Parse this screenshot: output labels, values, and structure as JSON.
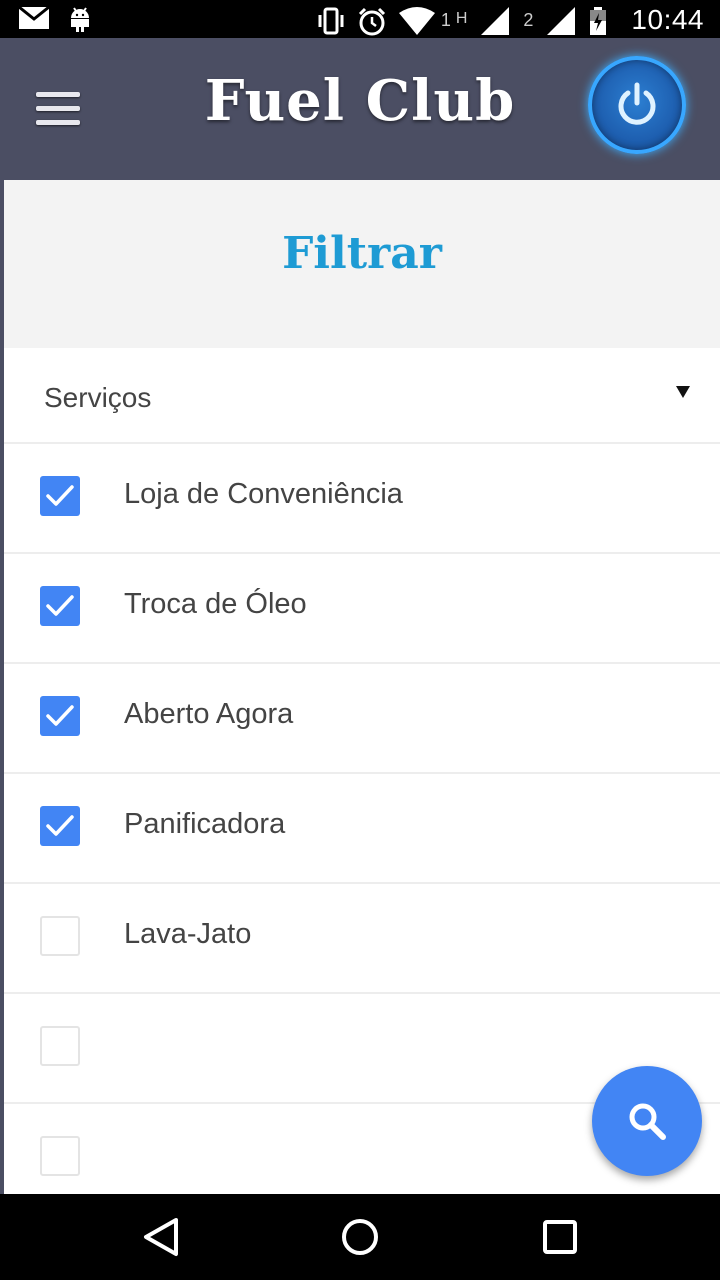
{
  "status_bar": {
    "time": "10:44",
    "sim1": "1",
    "sim1_type": "H",
    "sim2": "2",
    "icons": [
      "mail-icon",
      "android-icon",
      "vibrate-icon",
      "alarm-icon",
      "wifi-icon",
      "signal-icon",
      "signal-icon",
      "battery-icon"
    ]
  },
  "app_bar": {
    "title": "Fuel Club",
    "menu_icon": "hamburger-icon",
    "power_icon": "power-icon"
  },
  "filter": {
    "title": "Filtrar",
    "select": {
      "label": "Serviços"
    },
    "items": [
      {
        "label": "Loja de Conveniência",
        "checked": true
      },
      {
        "label": "Troca de Óleo",
        "checked": true
      },
      {
        "label": "Aberto Agora",
        "checked": true
      },
      {
        "label": "Panificadora",
        "checked": true
      },
      {
        "label": "Lava-Jato",
        "checked": false
      },
      {
        "label": "",
        "checked": false
      },
      {
        "label": "",
        "checked": false
      }
    ]
  },
  "fab": {
    "icon": "search-icon"
  },
  "nav_bar": {
    "icons": [
      "back-icon",
      "home-icon",
      "recents-icon"
    ]
  },
  "colors": {
    "app_bar": "#4b4e63",
    "accent_title": "#1e9bd4",
    "checkbox": "#4285f4",
    "power_ring": "#38a7ff"
  }
}
